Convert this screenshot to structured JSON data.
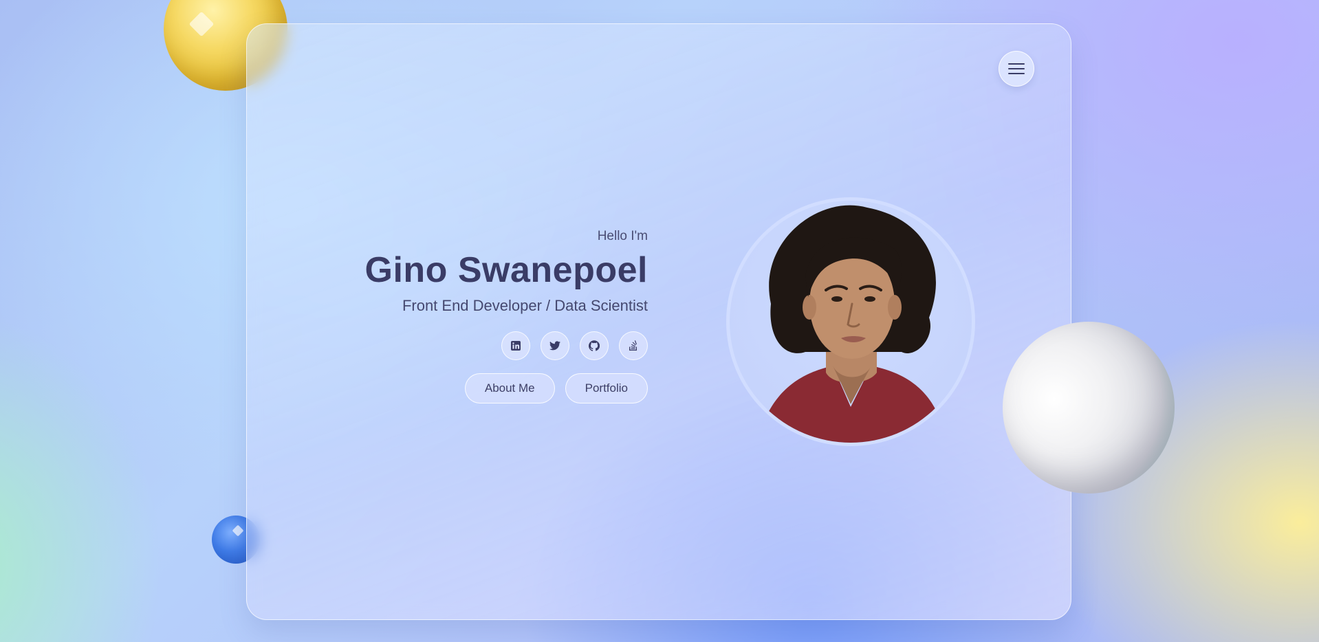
{
  "hero": {
    "greeting": "Hello I'm",
    "name": "Gino Swanepoel",
    "role": "Front End Developer / Data Scientist"
  },
  "social_links": [
    {
      "network": "LinkedIn",
      "icon": "linkedin-icon"
    },
    {
      "network": "Twitter",
      "icon": "twitter-icon"
    },
    {
      "network": "GitHub",
      "icon": "github-icon"
    },
    {
      "network": "Stack Overflow",
      "icon": "stack-overflow-icon"
    }
  ],
  "actions": {
    "about_label": "About Me",
    "portfolio_label": "Portfolio"
  },
  "menu": {
    "icon": "hamburger-menu-icon"
  },
  "colors": {
    "text_primary": "#3a3c66",
    "card_border": "#ffffff",
    "accent_yellow": "#f6d964",
    "accent_blue": "#3f7be6"
  }
}
